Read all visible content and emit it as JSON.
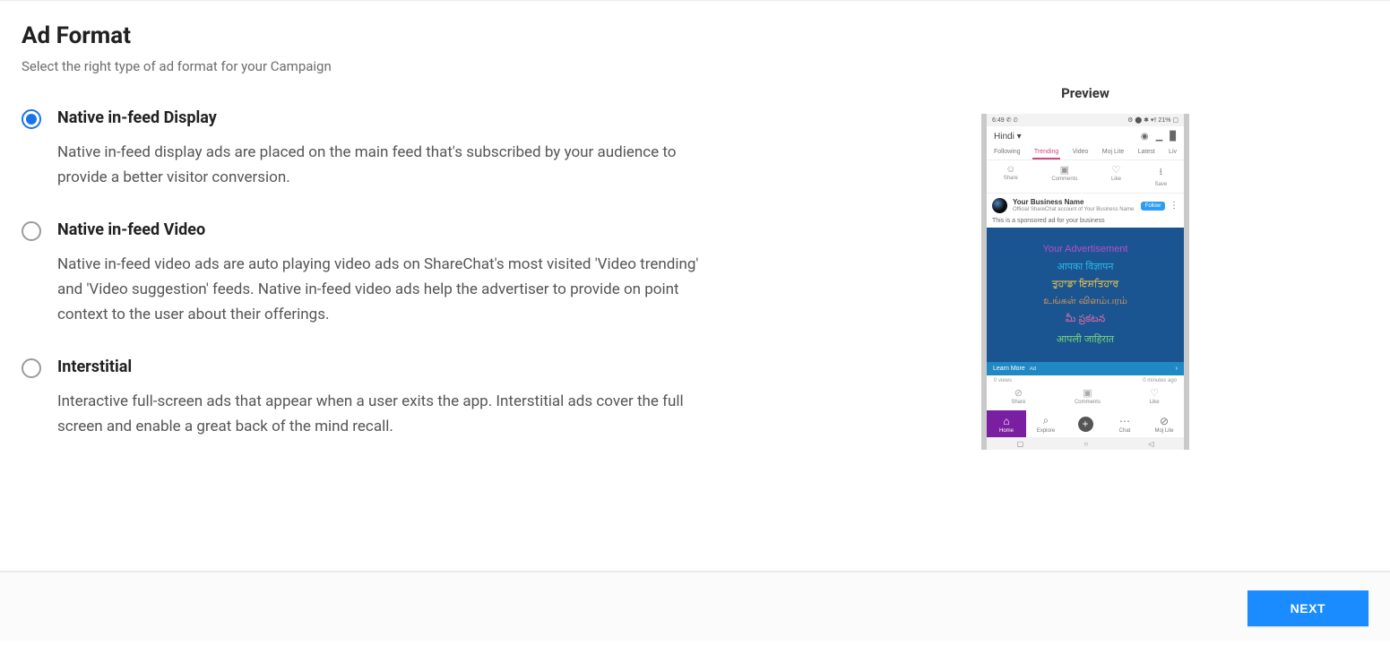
{
  "page": {
    "title": "Ad Format",
    "subtitle": "Select the right type of ad format for your Campaign"
  },
  "options": [
    {
      "id": "native-display",
      "title": "Native in-feed Display",
      "description": "Native in-feed display ads are placed on the main feed that's subscribed by your audience to provide a better visitor conversion.",
      "selected": true
    },
    {
      "id": "native-video",
      "title": "Native in-feed Video",
      "description": "Native in-feed video ads are auto playing video ads on ShareChat's most visited 'Video trending' and 'Video suggestion' feeds. Native in-feed video ads help the advertiser to provide on point context to the user about their offerings.",
      "selected": false
    },
    {
      "id": "interstitial",
      "title": "Interstitial",
      "description": "Interactive full-screen ads that appear when a user exits the app. Interstitial ads cover the full screen and enable a great back of the mind recall.",
      "selected": false
    }
  ],
  "preview": {
    "label": "Preview",
    "status_left": "6:49  ✆  ⏲",
    "status_right": "⚙ ⬤ ✱ ▾⫯ 21% ▢",
    "language": "Hindi",
    "language_caret": "▾",
    "top_icon_1": "◉",
    "top_icon_2": "▁",
    "top_icon_3": "▉",
    "tabs": [
      "Following",
      "Trending",
      "Video",
      "Moj Lite",
      "Latest",
      "Liv"
    ],
    "active_tab_index": 1,
    "shortcut_icons": [
      {
        "icon": "☺",
        "label": "Share"
      },
      {
        "icon": "▣",
        "label": "Comments"
      },
      {
        "icon": "♡",
        "label": "Like"
      },
      {
        "icon": "⭳",
        "label": "Save"
      }
    ],
    "post": {
      "business_name": "Your Business Name",
      "subtext": "Official ShareChat account of Your Business Name",
      "follow": "Follow",
      "sponsored_text": "This is a sponsored ad for your business"
    },
    "ad_lines": [
      {
        "text": "Your Advertisement",
        "color": "#b84fc9"
      },
      {
        "text": "आपका विज्ञापन",
        "color": "#2db6e6"
      },
      {
        "text": "ਤੁਹਾਡਾ ਇਸ਼ਤਿਹਾਰ",
        "color": "#f2c94c"
      },
      {
        "text": "உங்கள் விளம்பரம்",
        "color": "#f19e4b"
      },
      {
        "text": "మీ ప్రకటన",
        "color": "#e86aa6"
      },
      {
        "text": "आपली जाहिरात",
        "color": "#7bd37b"
      }
    ],
    "cta": {
      "label": "Learn More",
      "tag": "Ad",
      "chevron": "›"
    },
    "engage_left": "0 views",
    "engage_right": "0 minutes ago",
    "engage_icons": [
      {
        "icon": "⊘",
        "label": "Share"
      },
      {
        "icon": "▣",
        "label": "Comments"
      },
      {
        "icon": "♡",
        "label": "Like"
      }
    ],
    "bottom_nav": [
      {
        "icon": "⌂",
        "label": "Home",
        "active": true
      },
      {
        "icon": "⌕",
        "label": "Explore",
        "active": false
      },
      {
        "icon": "+",
        "label": "",
        "center": true
      },
      {
        "icon": "⋯",
        "label": "Chat",
        "active": false
      },
      {
        "icon": "⊘",
        "label": "Moj Lite",
        "active": false
      }
    ],
    "sys_nav": [
      "▢",
      "○",
      "◁"
    ]
  },
  "footer": {
    "next": "NEXT"
  }
}
